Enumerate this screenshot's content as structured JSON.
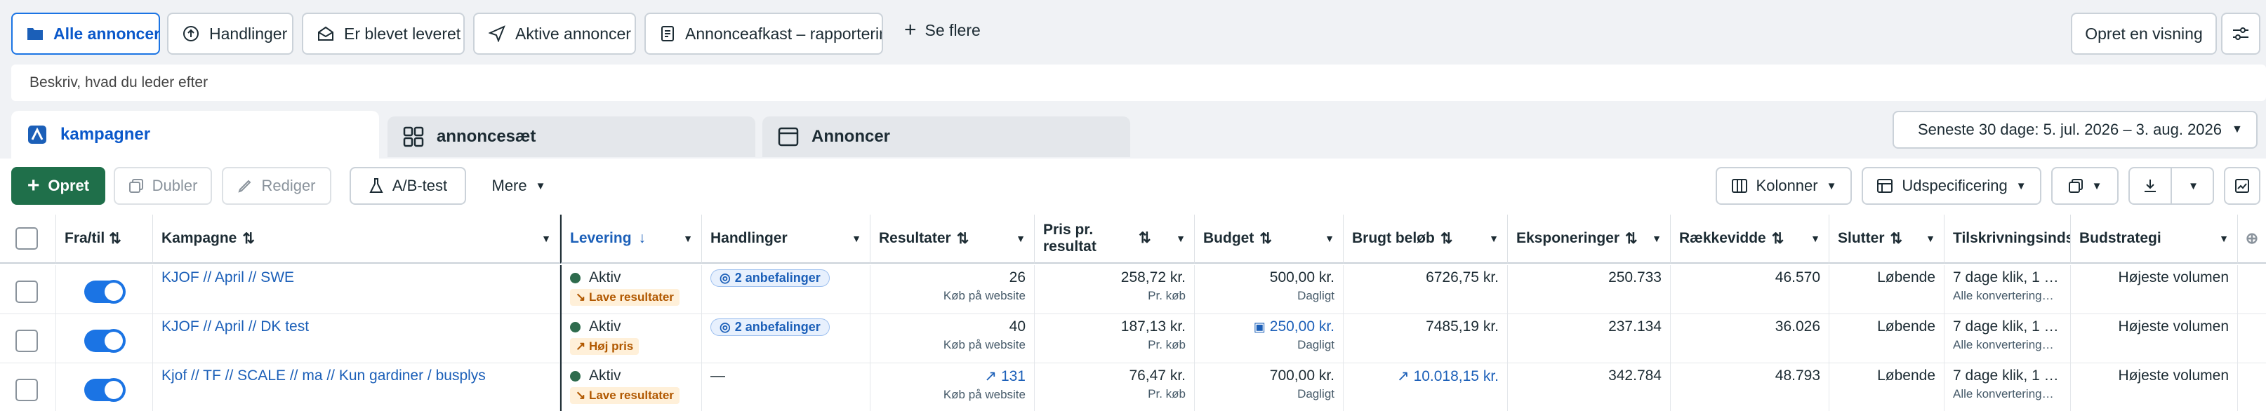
{
  "view_tabs": [
    {
      "label": "Alle annoncer",
      "icon": "folder-icon"
    },
    {
      "label": "Handlinger",
      "icon": "upload-circle-icon"
    },
    {
      "label": "Er blevet leveret",
      "icon": "mail-open-icon"
    },
    {
      "label": "Aktive annoncer",
      "icon": "send-icon"
    },
    {
      "label": "Annonceafkast – rapportering",
      "icon": "document-icon"
    }
  ],
  "see_more_label": "Se flere",
  "create_view_label": "Opret en visning",
  "search_placeholder": "Beskriv, hvad du leder efter",
  "level_tabs": [
    {
      "label": "kampagner",
      "icon": "campaign-folder-icon"
    },
    {
      "label": "annoncesæt",
      "icon": "grid-icon"
    },
    {
      "label": "Annoncer",
      "icon": "ad-window-icon"
    }
  ],
  "date_range": "Seneste 30 dage: 5. jul. 2026 – 3. aug. 2026",
  "toolbar": {
    "create": "Opret",
    "duplicate": "Dubler",
    "edit": "Rediger",
    "ab_test": "A/B-test",
    "more": "Mere",
    "columns": "Kolonner",
    "breakdown": "Udspecificering"
  },
  "headers": {
    "onoff": "Fra/til",
    "campaign": "Kampagne",
    "delivery": "Levering",
    "actions": "Handlinger",
    "results": "Resultater",
    "cost_per_result": "Pris pr. resultat",
    "budget": "Budget",
    "amount_spent": "Brugt beløb",
    "impressions": "Eksponeringer",
    "reach": "Rækkevidde",
    "ends": "Slutter",
    "attribution": "Tilskrivningsindstilling",
    "bid_strategy": "Budstrategi"
  },
  "rows": [
    {
      "name": "KJOF // April // SWE",
      "status": "Aktiv",
      "status_tag": "Lave resultater",
      "actions": "2 anbefalinger",
      "results": "26",
      "results_sub": "Køb på website",
      "cost": "258,72 kr.",
      "cost_sub": "Pr. køb",
      "budget": "500,00 kr.",
      "budget_sub": "Dagligt",
      "spent": "6726,75 kr.",
      "impressions": "250.733",
      "reach": "46.570",
      "ends": "Løbende",
      "attribution": "7 dage klik, 1 …",
      "attribution_sub": "Alle konvertering…",
      "bid": "Højeste volumen"
    },
    {
      "name": "KJOF // April // DK test",
      "status": "Aktiv",
      "status_tag": "Høj pris",
      "actions": "2 anbefalinger",
      "results": "40",
      "results_sub": "Køb på website",
      "cost": "187,13 kr.",
      "cost_sub": "Pr. køb",
      "budget": "250,00 kr.",
      "budget_sub": "Dagligt",
      "spent": "7485,19 kr.",
      "impressions": "237.134",
      "reach": "36.026",
      "ends": "Løbende",
      "attribution": "7 dage klik, 1 …",
      "attribution_sub": "Alle konvertering…",
      "bid": "Højeste volumen"
    },
    {
      "name": "Kjof // TF // SCALE // ma // Kun gardiner / busplys",
      "status": "Aktiv",
      "status_tag": "Lave resultater",
      "actions": "—",
      "results": "131",
      "results_sub": "Køb på website",
      "cost": "76,47 kr.",
      "cost_sub": "Pr. køb",
      "budget": "700,00 kr.",
      "budget_sub": "Dagligt",
      "spent": "10.018,15 kr.",
      "impressions": "342.784",
      "reach": "48.793",
      "ends": "Løbende",
      "attribution": "7 dage klik, 1 …",
      "attribution_sub": "Alle konvertering…",
      "bid": "Højeste volumen"
    }
  ],
  "colors": {
    "accent": "#1b74e4",
    "create_button": "#1f6f4a",
    "active_dot": "#2e6b4d",
    "warning": "#b15800"
  }
}
